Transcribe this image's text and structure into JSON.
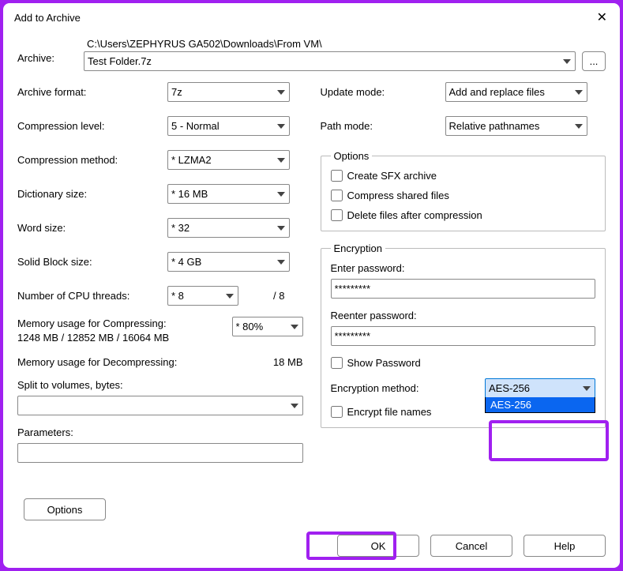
{
  "title": "Add to Archive",
  "archive": {
    "label": "Archive:",
    "path": "C:\\Users\\ZEPHYRUS GA502\\Downloads\\From VM\\",
    "filename": "Test Folder.7z",
    "browse_label": "..."
  },
  "left": {
    "format": {
      "label": "Archive format:",
      "value": "7z"
    },
    "level": {
      "label": "Compression level:",
      "value": "5 - Normal"
    },
    "method": {
      "label": "Compression method:",
      "value": "* LZMA2"
    },
    "dict": {
      "label": "Dictionary size:",
      "value": "* 16 MB"
    },
    "word": {
      "label": "Word size:",
      "value": "* 32"
    },
    "block": {
      "label": "Solid Block size:",
      "value": "* 4 GB"
    },
    "threads": {
      "label": "Number of CPU threads:",
      "value": "* 8",
      "total": "/ 8"
    },
    "mem_compress": {
      "label": "Memory usage for Compressing:",
      "detail": "1248 MB / 12852 MB / 16064 MB",
      "value": "* 80%"
    },
    "mem_decompress": {
      "label": "Memory usage for Decompressing:",
      "value": "18 MB"
    },
    "split": {
      "label": "Split to volumes, bytes:",
      "value": ""
    },
    "params": {
      "label": "Parameters:",
      "value": ""
    }
  },
  "right": {
    "update": {
      "label": "Update mode:",
      "value": "Add and replace files"
    },
    "pathmode": {
      "label": "Path mode:",
      "value": "Relative pathnames"
    },
    "options": {
      "legend": "Options",
      "sfx": "Create SFX archive",
      "shared": "Compress shared files",
      "delete": "Delete files after compression"
    },
    "encryption": {
      "legend": "Encryption",
      "enter_pw": "Enter password:",
      "reenter_pw": "Reenter password:",
      "pw_value": "*********",
      "show_pw": "Show Password",
      "method_label": "Encryption method:",
      "method_value": "AES-256",
      "dropdown_option": "AES-256",
      "encrypt_names": "Encrypt file names"
    }
  },
  "buttons": {
    "options": "Options",
    "ok": "OK",
    "cancel": "Cancel",
    "help": "Help"
  }
}
